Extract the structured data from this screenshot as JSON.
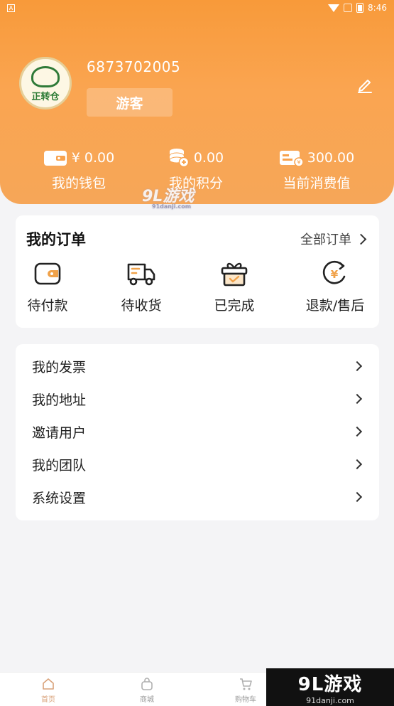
{
  "status_bar": {
    "time": "8:46",
    "left_indicator": "A"
  },
  "profile": {
    "avatar_text": "正转仓",
    "user_id": "6873702005",
    "role_label": "游客"
  },
  "stats": [
    {
      "value": "¥ 0.00",
      "label": "我的钱包",
      "icon": "wallet-icon"
    },
    {
      "value": "0.00",
      "label": "我的积分",
      "icon": "coins-icon"
    },
    {
      "value": "300.00",
      "label": "当前消费值",
      "icon": "card-icon"
    }
  ],
  "orders": {
    "title": "我的订单",
    "all_label": "全部订单",
    "items": [
      {
        "label": "待付款",
        "icon": "wallet-icon"
      },
      {
        "label": "待收货",
        "icon": "truck-icon"
      },
      {
        "label": "已完成",
        "icon": "gift-icon"
      },
      {
        "label": "退款/售后",
        "icon": "refund-icon"
      }
    ]
  },
  "menu": [
    {
      "label": "我的发票"
    },
    {
      "label": "我的地址"
    },
    {
      "label": "邀请用户"
    },
    {
      "label": "我的团队"
    },
    {
      "label": "系统设置"
    }
  ],
  "tabbar": [
    {
      "label": "首页",
      "icon": "home-icon"
    },
    {
      "label": "商城",
      "icon": "bag-icon"
    },
    {
      "label": "购物车",
      "icon": "cart-icon"
    }
  ],
  "watermark": {
    "brand": "9L游戏",
    "url": "91danji.com",
    "center_brand": "9L游戏",
    "center_url": "91danji.com"
  },
  "colors": {
    "header_orange": "#f89a3a",
    "accent": "#f0a24a",
    "background": "#f4f4f6"
  }
}
